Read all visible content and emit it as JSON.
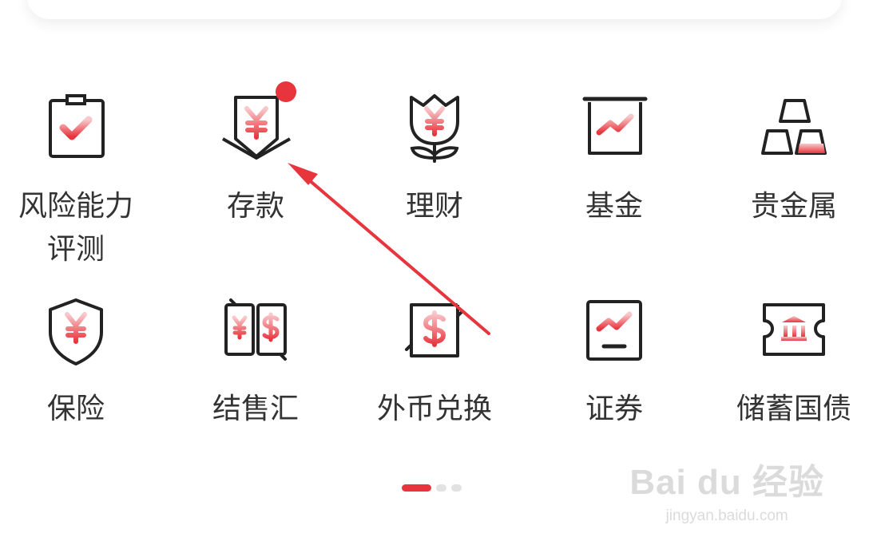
{
  "menu": {
    "items": [
      {
        "label": "风险能力\n评测",
        "icon": "clipboard-check-icon"
      },
      {
        "label": "存款",
        "icon": "deposit-yuan-icon",
        "badge": true
      },
      {
        "label": "理财",
        "icon": "tulip-yuan-icon"
      },
      {
        "label": "基金",
        "icon": "fund-chart-icon"
      },
      {
        "label": "贵金属",
        "icon": "gold-bars-icon"
      },
      {
        "label": "保险",
        "icon": "shield-yuan-icon"
      },
      {
        "label": "结售汇",
        "icon": "yuan-dollar-exchange-icon"
      },
      {
        "label": "外币兑换",
        "icon": "dollar-exchange-icon"
      },
      {
        "label": "证券",
        "icon": "securities-chart-icon"
      },
      {
        "label": "储蓄国债",
        "icon": "treasury-bond-ticket-icon"
      }
    ]
  },
  "pager": {
    "count": 3,
    "active": 0
  },
  "watermark": {
    "brand": "Bai du 经验",
    "sub": "jingyan.baidu.com"
  },
  "colors": {
    "accent": "#e8353d",
    "stroke": "#222222",
    "text": "#333333"
  }
}
